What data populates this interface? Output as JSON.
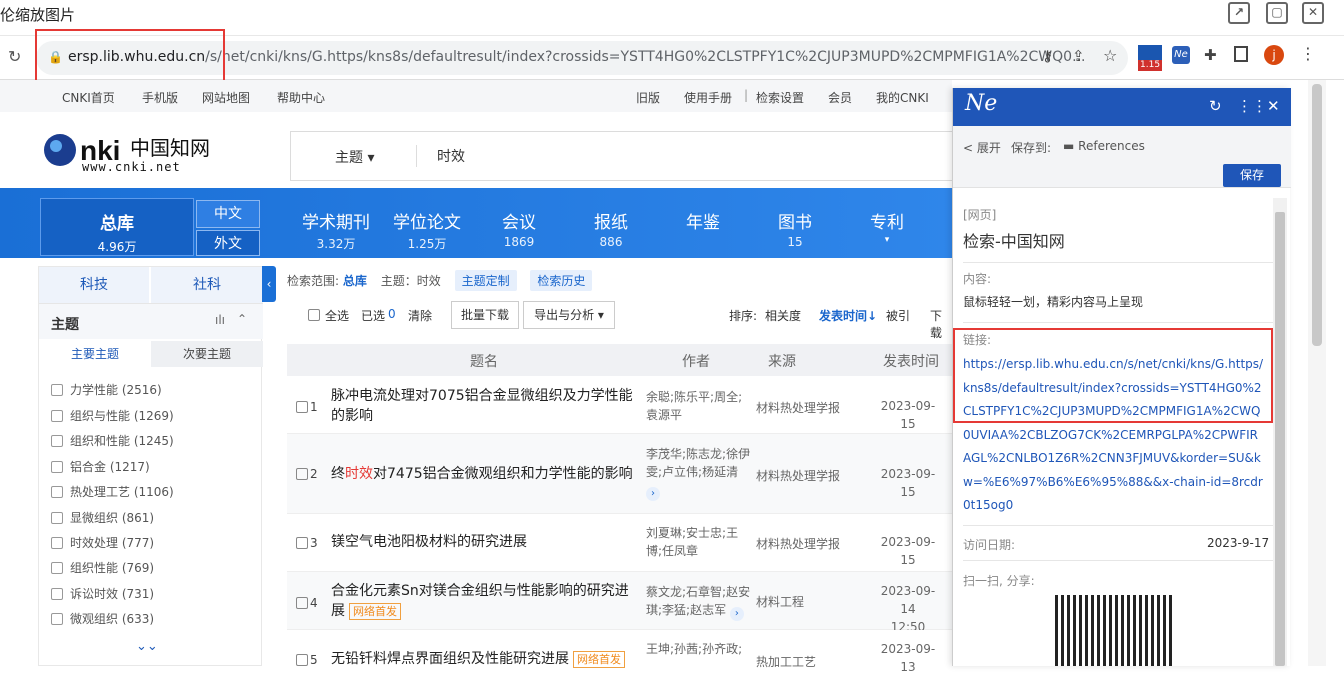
{
  "window": {
    "title": "伦缩放图片"
  },
  "address": {
    "host": "ersp.lib.whu.edu.cn",
    "path": "/s/net/cnki/kns/G.https/kns8s/defaultresult/index?crossids=YSTT4HG0%2CLSTPFY1C%2CJUP3MUPD%2CMPMFIG1A%2CWQ0...",
    "ext_badge": "1.15",
    "profile_letter": "j"
  },
  "topnav": {
    "left": [
      "CNKI首页",
      "手机版",
      "网站地图",
      "帮助中心"
    ],
    "right": [
      "旧版",
      "使用手册",
      "检索设置",
      "会员",
      "我的CNKI"
    ]
  },
  "logo": {
    "cn": "中国知网",
    "url": "www.cnki.net"
  },
  "search": {
    "field": "主题",
    "query": "时效"
  },
  "zongku": {
    "label": "总库",
    "count": "4.96万"
  },
  "lang": {
    "cn": "中文",
    "foreign": "外文"
  },
  "nav": [
    {
      "label": "学术期刊",
      "count": "3.32万"
    },
    {
      "label": "学位论文",
      "count": "1.25万"
    },
    {
      "label": "会议",
      "count": "1869"
    },
    {
      "label": "报纸",
      "count": "886"
    },
    {
      "label": "年鉴",
      "count": ""
    },
    {
      "label": "图书",
      "count": "15"
    },
    {
      "label": "专利",
      "count": ""
    }
  ],
  "left": {
    "tab1": "科技",
    "tab2": "社科",
    "section": "主题",
    "sub1": "主要主题",
    "sub2": "次要主题",
    "facets": [
      "力学性能 (2516)",
      "组织与性能 (1269)",
      "组织和性能 (1245)",
      "铝合金 (1217)",
      "热处理工艺 (1106)",
      "显微组织 (861)",
      "时效处理 (777)",
      "组织性能 (769)",
      "诉讼时效 (731)",
      "微观组织 (633)"
    ]
  },
  "scope": {
    "label": "检索范围:",
    "db": "总库",
    "topic": "主题：时效",
    "btn1": "主题定制",
    "btn2": "检索历史"
  },
  "toolbar": {
    "select_all": "全选",
    "selected": "已选",
    "selected_count": "0",
    "clear": "清除",
    "batch": "批量下载",
    "export": "导出与分析",
    "sort_label": "排序:",
    "sort_rel": "相关度",
    "sort_date": "发表时间",
    "sort_cite": "被引",
    "sort_dl": "下载"
  },
  "thead": {
    "title": "题名",
    "author": "作者",
    "source": "来源",
    "date": "发表时间"
  },
  "rows": [
    {
      "no": "1",
      "title": "脉冲电流处理对7075铝合金显微组织及力学性能的影响",
      "author": "余聪;陈乐平;周全;袁源平",
      "source": "材料热处理学报",
      "date": "2023-09-15",
      "time": ""
    },
    {
      "no": "2",
      "title_pre": "终",
      "title_hl": "时效",
      "title_post": "对7475铝合金微观组织和力学性能的影响",
      "author": "李茂华;陈志龙;徐伊雯;卢立伟;杨延清",
      "source": "材料热处理学报",
      "date": "2023-09-15",
      "time": ""
    },
    {
      "no": "3",
      "title": "镁空气电池阳极材料的研究进展",
      "author": "刘夏琳;安士忠;王博;任凤章",
      "source": "材料热处理学报",
      "date": "2023-09-15",
      "time": ""
    },
    {
      "no": "4",
      "title": "合金化元素Sn对镁合金组织与性能影响的研究进展",
      "badge": "网络首发",
      "author": "蔡文龙;石章智;赵安琪;李猛;赵志军",
      "source": "材料工程",
      "date": "2023-09-14",
      "time": "12:50"
    },
    {
      "no": "5",
      "title": "无铅钎料焊点界面组织及性能研究进展",
      "badge": "网络首发",
      "author": "王坤;孙茜;孙齐政;",
      "source": "热加工工艺",
      "date": "2023-09-13",
      "time": ""
    }
  ],
  "panel": {
    "logo": "Ne",
    "expand": "< 展开",
    "save_to": "保存到:",
    "folder": "References",
    "save": "保存",
    "type": "[网页]",
    "title": "检索-中国知网",
    "content_label": "内容:",
    "content": "鼠标轻轻一划，精彩内容马上呈现",
    "link_label": "链接:",
    "link": "https://ersp.lib.whu.edu.cn/s/net/cnki/kns/G.https/kns8s/defaultresult/index?crossids=YSTT4HG0%2CLSTPFY1C%2CJUP3MUPD%2CMPMFIG1A%2CWQ0UVIAA%2CBLZOG7CK%2CEMRPGLPA%2CPWFIRAGL%2CNLBO1Z6R%2CNN3FJMUV&korder=SU&kw=%E6%97%B6%E6%95%88&&x-chain-id=8rcdr0t15og0",
    "visit_label": "访问日期:",
    "visit_date": "2023-9-17",
    "share_label": "扫一扫, 分享:"
  },
  "colors": {
    "primary": "#1f56b8",
    "nav": "#1a6fd6",
    "highlight": "#e53935"
  }
}
